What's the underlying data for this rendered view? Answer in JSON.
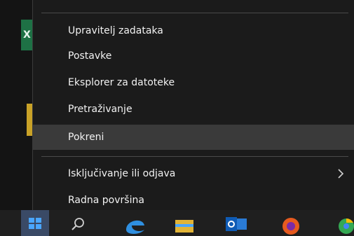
{
  "menu": {
    "items": [
      {
        "label": "Upravitelj zadataka"
      },
      {
        "label": "Postavke"
      },
      {
        "label": "Eksplorer za datoteke"
      },
      {
        "label": "Pretraživanje"
      },
      {
        "label": "Pokreni"
      },
      {
        "label": "Isključivanje ili odjava",
        "has_submenu": true
      },
      {
        "label": "Radna površina"
      }
    ],
    "hovered_item": "Pokreni",
    "submenu_icon": "chevron-right-icon"
  },
  "desktop": {
    "icons": [
      "excel-icon",
      "folder-icon"
    ],
    "excel_glyph": "X"
  },
  "taskbar": {
    "icons": [
      "windows-start-icon",
      "search-icon",
      "edge-icon",
      "file-explorer-icon",
      "outlook-icon",
      "firefox-icon",
      "chrome-icon"
    ]
  },
  "colors": {
    "menu_bg": "#1b1b1b",
    "hover_bg": "#3a3a3a",
    "text": "#f2f2f2",
    "accent_blue": "#4aa6ff"
  }
}
